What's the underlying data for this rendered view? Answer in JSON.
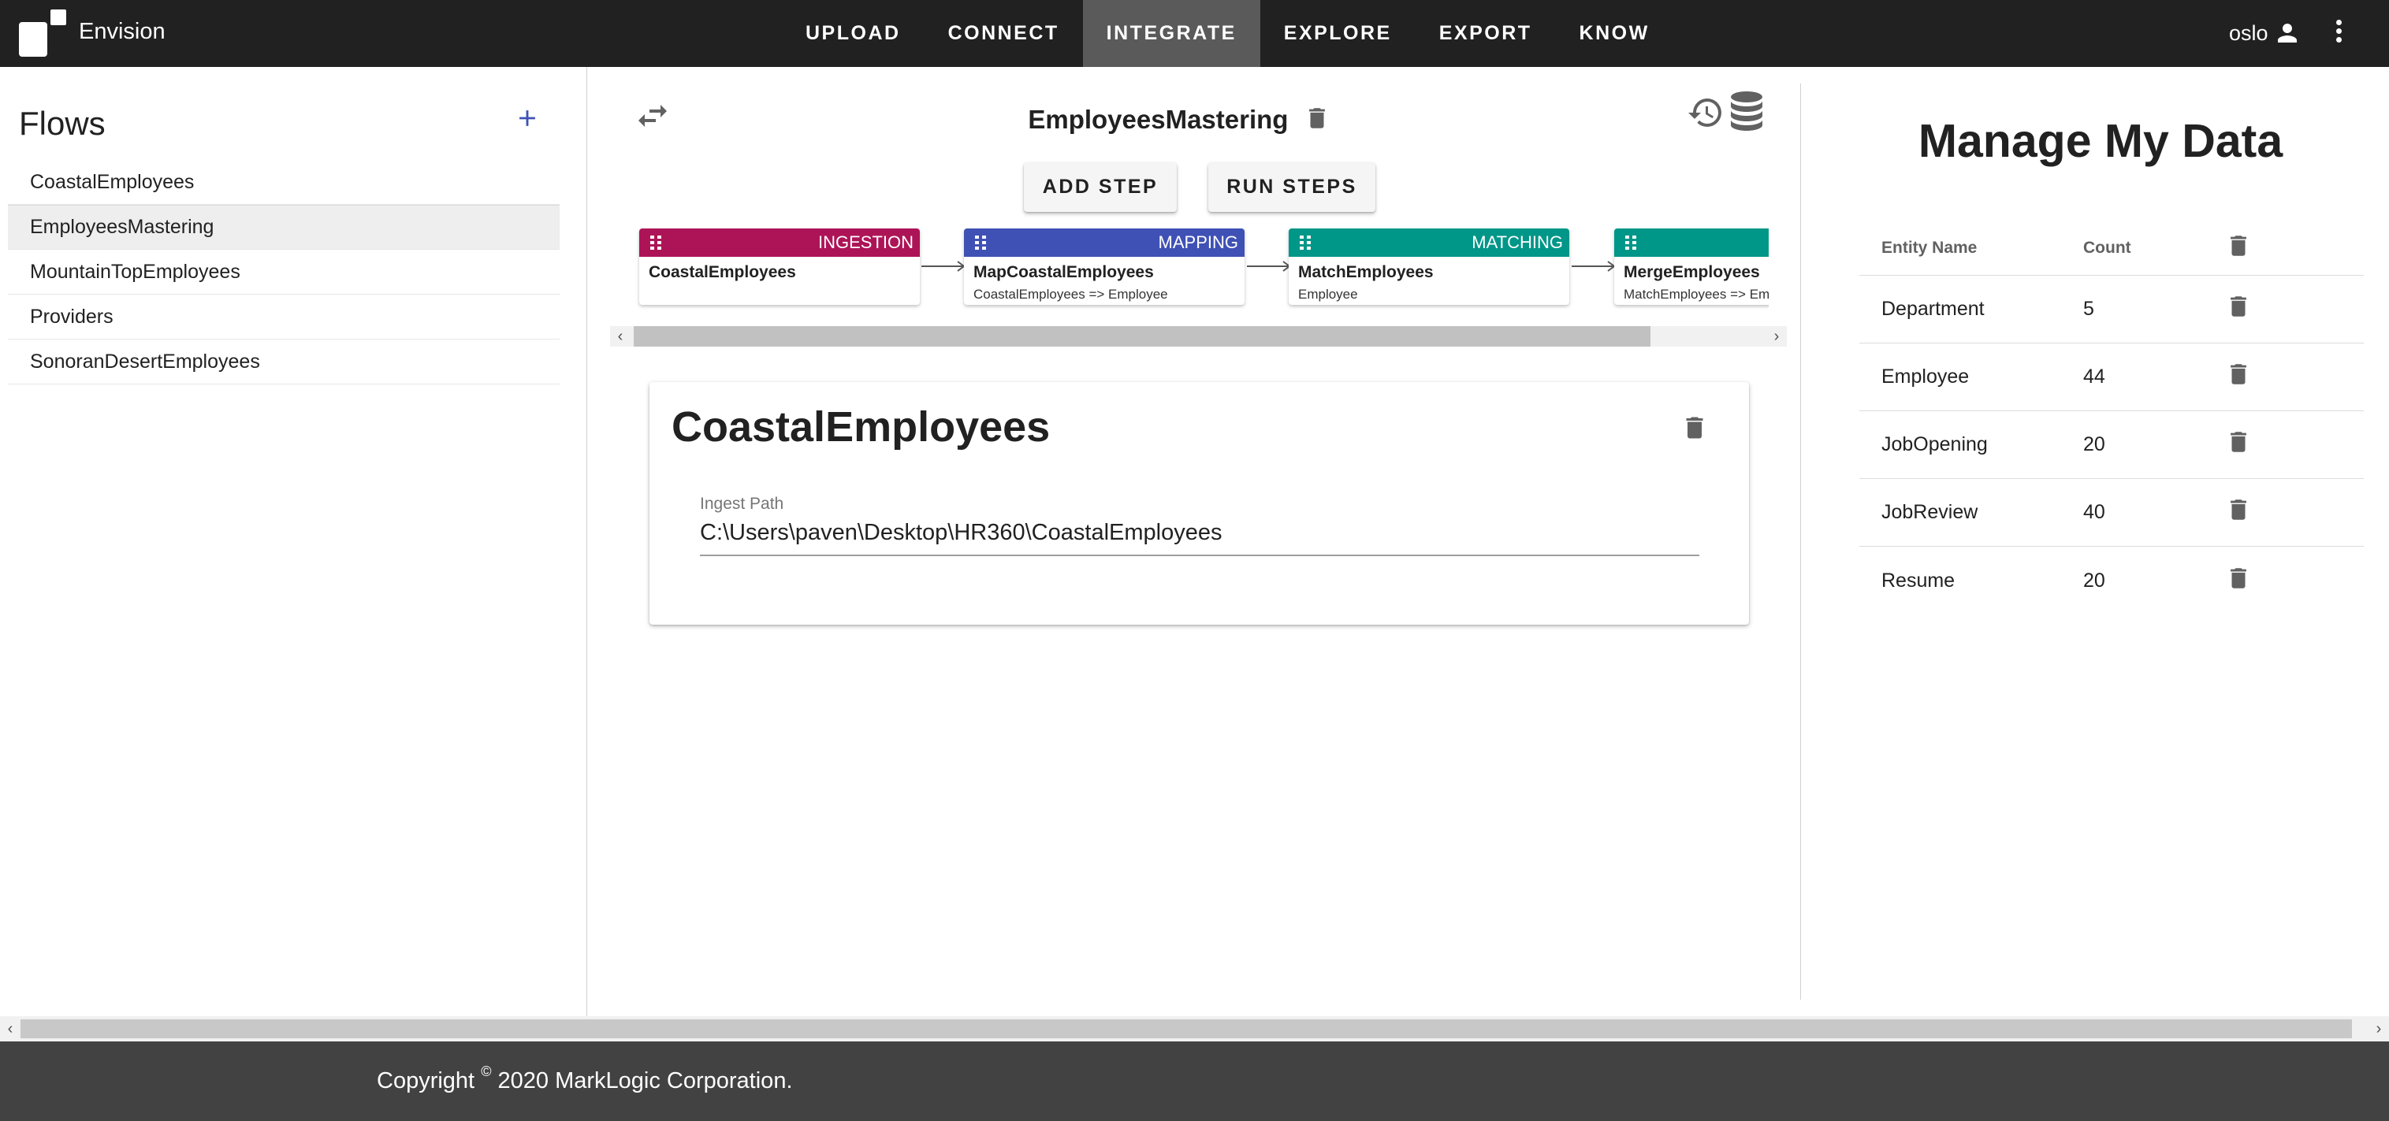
{
  "app": {
    "name": "Envision"
  },
  "nav": {
    "items": [
      "UPLOAD",
      "CONNECT",
      "INTEGRATE",
      "EXPLORE",
      "EXPORT",
      "KNOW"
    ],
    "active": "INTEGRATE"
  },
  "user": {
    "name": "oslo"
  },
  "sidebar": {
    "title": "Flows",
    "flows": [
      "CoastalEmployees",
      "EmployeesMastering",
      "MountainTopEmployees",
      "Providers",
      "SonoranDesertEmployees"
    ],
    "selected": "EmployeesMastering"
  },
  "flow": {
    "name": "EmployeesMastering",
    "add_step_label": "ADD STEP",
    "run_steps_label": "RUN STEPS",
    "steps": [
      {
        "type": "INGESTION",
        "name": "CoastalEmployees",
        "sub": "",
        "color": "#ad1457"
      },
      {
        "type": "MAPPING",
        "name": "MapCoastalEmployees",
        "sub": "CoastalEmployees => Employee",
        "color": "#3f51b5"
      },
      {
        "type": "MATCHING",
        "name": "MatchEmployees",
        "sub": "Employee",
        "color": "#009688"
      },
      {
        "type": "",
        "name": "MergeEmployees",
        "sub": "MatchEmployees => Employee",
        "color": "#009688"
      }
    ]
  },
  "step_detail": {
    "title": "CoastalEmployees",
    "field_label": "Ingest Path",
    "field_value": "C:\\Users\\paven\\Desktop\\HR360\\CoastalEmployees"
  },
  "manage": {
    "title": "Manage My Data",
    "columns": [
      "Entity Name",
      "Count"
    ],
    "rows": [
      {
        "entity": "Department",
        "count": "5"
      },
      {
        "entity": "Employee",
        "count": "44"
      },
      {
        "entity": "JobOpening",
        "count": "20"
      },
      {
        "entity": "JobReview",
        "count": "40"
      },
      {
        "entity": "Resume",
        "count": "20"
      }
    ]
  },
  "footer": {
    "prefix": "Copyright",
    "symbol": "©",
    "suffix": "2020 MarkLogic Corporation."
  },
  "icons": {
    "delete": "trash-icon",
    "swap": "swap-icon",
    "history": "history-icon",
    "database": "database-icon",
    "add": "plus-icon",
    "user": "person-icon",
    "more": "more-vert-icon"
  }
}
